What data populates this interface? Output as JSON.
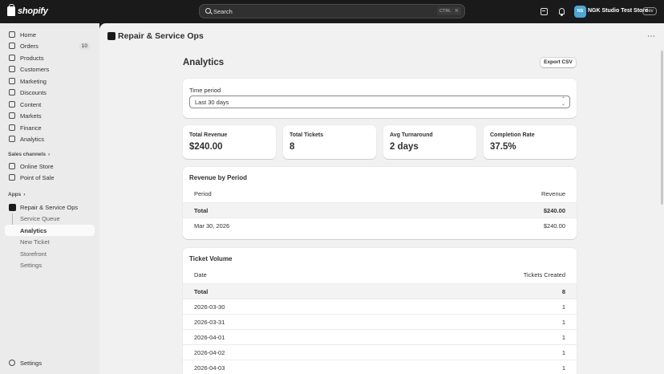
{
  "topbar": {
    "brand": "shopify",
    "search_placeholder": "Search",
    "shortcut_ctrl": "CTRL",
    "shortcut_key": "K",
    "avatar_initials": "NS",
    "store_name": "NGK Studio Test Store",
    "env_badge": "dev"
  },
  "sidebar": {
    "items": [
      {
        "label": "Home",
        "icon": "home-icon"
      },
      {
        "label": "Orders",
        "icon": "orders-icon",
        "badge": "10"
      },
      {
        "label": "Products",
        "icon": "products-icon"
      },
      {
        "label": "Customers",
        "icon": "customers-icon"
      },
      {
        "label": "Marketing",
        "icon": "marketing-icon"
      },
      {
        "label": "Discounts",
        "icon": "discounts-icon"
      },
      {
        "label": "Content",
        "icon": "content-icon"
      },
      {
        "label": "Markets",
        "icon": "markets-icon"
      },
      {
        "label": "Finance",
        "icon": "finance-icon"
      },
      {
        "label": "Analytics",
        "icon": "analytics-icon"
      }
    ],
    "sales_channels_heading": "Sales channels",
    "sales_channels": [
      {
        "label": "Online Store",
        "icon": "online-store-icon"
      },
      {
        "label": "Point of Sale",
        "icon": "pos-icon"
      }
    ],
    "apps_heading": "Apps",
    "app_name": "Repair & Service Ops",
    "app_subitems": [
      "Service Queue",
      "Analytics",
      "New Ticket",
      "Storefront",
      "Settings"
    ],
    "active_subitem": "Analytics",
    "footer_settings": "Settings"
  },
  "main": {
    "app_title": "Repair & Service Ops",
    "page_title": "Analytics",
    "export_label": "Export CSV",
    "time_period": {
      "label": "Time period",
      "value": "Last 30 days"
    },
    "stats": [
      {
        "label": "Total Revenue",
        "value": "$240.00"
      },
      {
        "label": "Total Tickets",
        "value": "8"
      },
      {
        "label": "Avg Turnaround",
        "value": "2 days"
      },
      {
        "label": "Completion Rate",
        "value": "37.5%"
      }
    ],
    "revenue_table": {
      "title": "Revenue by Period",
      "columns": [
        "Period",
        "Revenue"
      ],
      "rows": [
        [
          "Total",
          "$240.00"
        ],
        [
          "Mar 30, 2026",
          "$240.00"
        ]
      ]
    },
    "volume_table": {
      "title": "Ticket Volume",
      "columns": [
        "Date",
        "Tickets Created"
      ],
      "rows": [
        [
          "Total",
          "8"
        ],
        [
          "2026-03-30",
          "1"
        ],
        [
          "2026-03-31",
          "1"
        ],
        [
          "2026-04-01",
          "1"
        ],
        [
          "2026-04-02",
          "1"
        ],
        [
          "2026-04-03",
          "1"
        ]
      ]
    }
  }
}
